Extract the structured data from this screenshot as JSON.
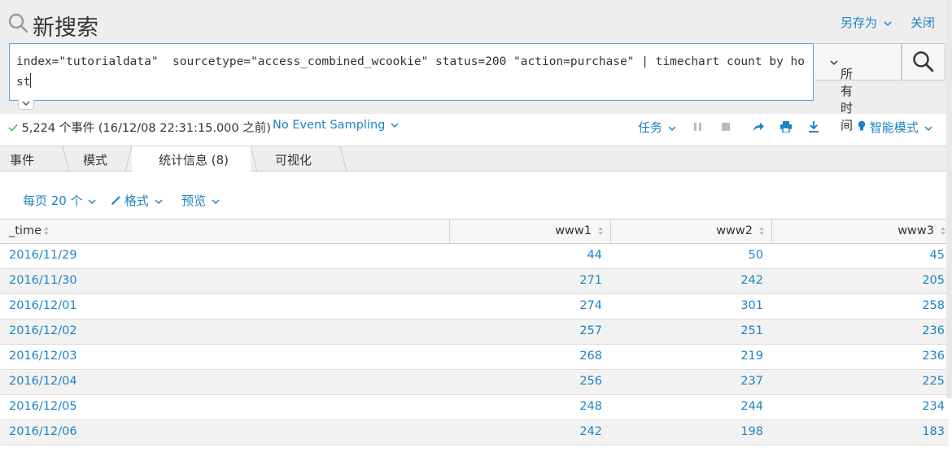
{
  "header": {
    "title": "新搜索",
    "save_as": "另存为",
    "close": "关闭"
  },
  "search": {
    "query": "index=\"tutorialdata\"  sourcetype=\"access_combined_wcookie\" status=200 \"action=purchase\" | timechart count by host",
    "time_range": "所有时间"
  },
  "status": {
    "events": "5,224 个事件 (16/12/08 22:31:15.000 之前)",
    "sampling": "No Event Sampling",
    "job": "任务",
    "mode": "智能模式"
  },
  "tabs": [
    {
      "label": "事件"
    },
    {
      "label": "模式"
    },
    {
      "label": "统计信息 (8)"
    },
    {
      "label": "可视化"
    }
  ],
  "table_controls": {
    "per_page": "每页 20 个",
    "format": "格式",
    "preview": "预览"
  },
  "table": {
    "columns": [
      "_time",
      "www1",
      "www2",
      "www3"
    ],
    "rows": [
      [
        "2016/11/29",
        "44",
        "50",
        "45"
      ],
      [
        "2016/11/30",
        "271",
        "242",
        "205"
      ],
      [
        "2016/12/01",
        "274",
        "301",
        "258"
      ],
      [
        "2016/12/02",
        "257",
        "251",
        "236"
      ],
      [
        "2016/12/03",
        "268",
        "219",
        "236"
      ],
      [
        "2016/12/04",
        "256",
        "237",
        "225"
      ],
      [
        "2016/12/05",
        "248",
        "244",
        "234"
      ],
      [
        "2016/12/06",
        "242",
        "198",
        "183"
      ]
    ]
  },
  "colors": {
    "accent": "#1e83c5",
    "header_bg": "#eeeeee",
    "check": "#5cc05c"
  }
}
